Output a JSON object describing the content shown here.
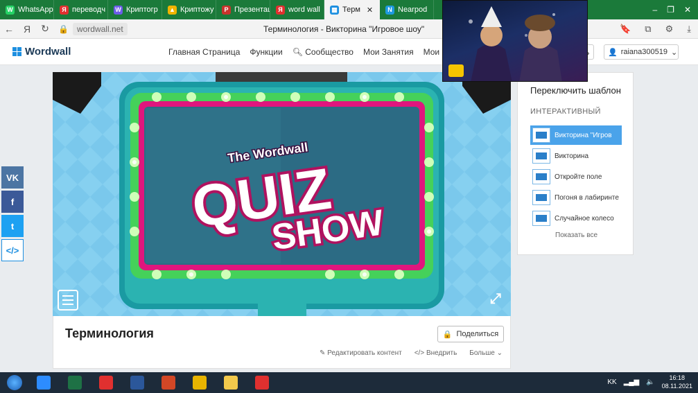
{
  "browser": {
    "tabs": [
      {
        "label": "WhatsApp",
        "color": "#25d366",
        "glyph": "W"
      },
      {
        "label": "переводч",
        "color": "#e0302f",
        "glyph": "Я"
      },
      {
        "label": "Криптогр",
        "color": "#6c5ce7",
        "glyph": "W"
      },
      {
        "label": "Криптожу",
        "color": "#f0b400",
        "glyph": "▲"
      },
      {
        "label": "Презентац",
        "color": "#c8342c",
        "glyph": "P"
      },
      {
        "label": "word wall",
        "color": "#e0302f",
        "glyph": "Я"
      },
      {
        "label": "Терм",
        "color": "#1d8fe0",
        "glyph": "▦"
      },
      {
        "label": "Nearpod",
        "color": "#1e9ae0",
        "glyph": "N"
      }
    ],
    "url": "wordwall.net",
    "page_title": "Терминология - Викторина \"Игровое шоу\""
  },
  "nav": {
    "logo": "Wordwall",
    "links": [
      "Главная Страница",
      "Функции",
      "Сообщество",
      "Мои Занятия",
      "Мои Резуль"
    ],
    "lk_button": "ль",
    "username": "raiana300519"
  },
  "game": {
    "banner_small": "The Wordwall",
    "banner_big1": "QUIZ",
    "banner_big2": "SHOW",
    "colors": {
      "sky": "#7ac8ec",
      "frame": "#2bb3b1",
      "lights": "#8dff6e",
      "magenta": "#e0167d",
      "panel": "#2c6b84"
    }
  },
  "activity": {
    "title": "Терминология",
    "share": "Поделиться",
    "edit": "Редактировать контент",
    "embed": "Внедрить",
    "more": "Больше"
  },
  "sidebar": {
    "header": "Переключить шаблон",
    "section": "ИНТЕРАКТИВНЫЙ",
    "templates": [
      {
        "label": "Викторина \"Игров",
        "active": true
      },
      {
        "label": "Викторина",
        "active": false
      },
      {
        "label": "Откройте поле",
        "active": false
      },
      {
        "label": "Погоня в лабиринте",
        "active": false
      },
      {
        "label": "Случайное колесо",
        "active": false
      }
    ],
    "show_all": "Показать все"
  },
  "social": [
    {
      "name": "vk",
      "glyph": "VK",
      "color": "#4c75a3"
    },
    {
      "name": "facebook",
      "glyph": "f",
      "color": "#3b5998"
    },
    {
      "name": "twitter",
      "glyph": "t",
      "color": "#1da1f2"
    },
    {
      "name": "embed",
      "glyph": "</>",
      "color": "#ffffff"
    }
  ],
  "taskbar": {
    "apps": [
      {
        "name": "zoom",
        "color": "#2d8cff"
      },
      {
        "name": "excel",
        "color": "#1e7145"
      },
      {
        "name": "yandex",
        "color": "#e0302f"
      },
      {
        "name": "word",
        "color": "#2b579a"
      },
      {
        "name": "powerpoint",
        "color": "#d24726"
      },
      {
        "name": "chrome",
        "color": "#e8b400"
      },
      {
        "name": "explorer",
        "color": "#f2c94c"
      },
      {
        "name": "yandex-browser",
        "color": "#e0302f"
      }
    ],
    "lang": "KK",
    "time": "16:18",
    "date": "08.11.2021"
  }
}
